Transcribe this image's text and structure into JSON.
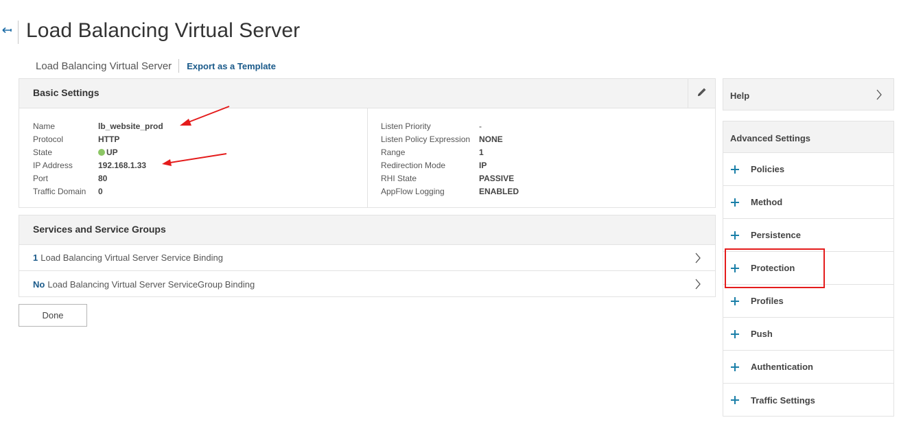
{
  "page": {
    "title": "Load Balancing Virtual Server",
    "back_icon": "back-arrow-icon"
  },
  "sub_nav": {
    "title": "Load Balancing Virtual Server",
    "export_label": "Export as a Template"
  },
  "basic_settings": {
    "title": "Basic Settings",
    "edit_icon": "pencil-icon",
    "left": [
      {
        "label": "Name",
        "value": "lb_website_prod"
      },
      {
        "label": "Protocol",
        "value": "HTTP"
      },
      {
        "label": "State",
        "value": "UP",
        "status_color": "#8cc665"
      },
      {
        "label": "IP Address",
        "value": "192.168.1.33"
      },
      {
        "label": "Port",
        "value": "80"
      },
      {
        "label": "Traffic Domain",
        "value": "0"
      }
    ],
    "right": [
      {
        "label": "Listen Priority",
        "value": "-"
      },
      {
        "label": "Listen Policy Expression",
        "value": "NONE"
      },
      {
        "label": "Range",
        "value": "1"
      },
      {
        "label": "Redirection Mode",
        "value": "IP"
      },
      {
        "label": "RHI State",
        "value": "PASSIVE"
      },
      {
        "label": "AppFlow Logging",
        "value": "ENABLED"
      }
    ]
  },
  "services": {
    "title": "Services and Service Groups",
    "rows": [
      {
        "count": "1",
        "label": "Load Balancing Virtual Server Service Binding"
      },
      {
        "count": "No",
        "label": "Load Balancing Virtual Server ServiceGroup Binding"
      }
    ]
  },
  "done_label": "Done",
  "help": {
    "label": "Help"
  },
  "advanced": {
    "title": "Advanced Settings",
    "items": [
      {
        "label": "Policies"
      },
      {
        "label": "Method"
      },
      {
        "label": "Persistence"
      },
      {
        "label": "Protection"
      },
      {
        "label": "Profiles"
      },
      {
        "label": "Push"
      },
      {
        "label": "Authentication"
      },
      {
        "label": "Traffic Settings"
      }
    ]
  },
  "colors": {
    "accent": "#1a5a8a",
    "plus_icon": "#1a7fa8",
    "annotation": "#e41b1b",
    "status_up": "#8cc665"
  }
}
